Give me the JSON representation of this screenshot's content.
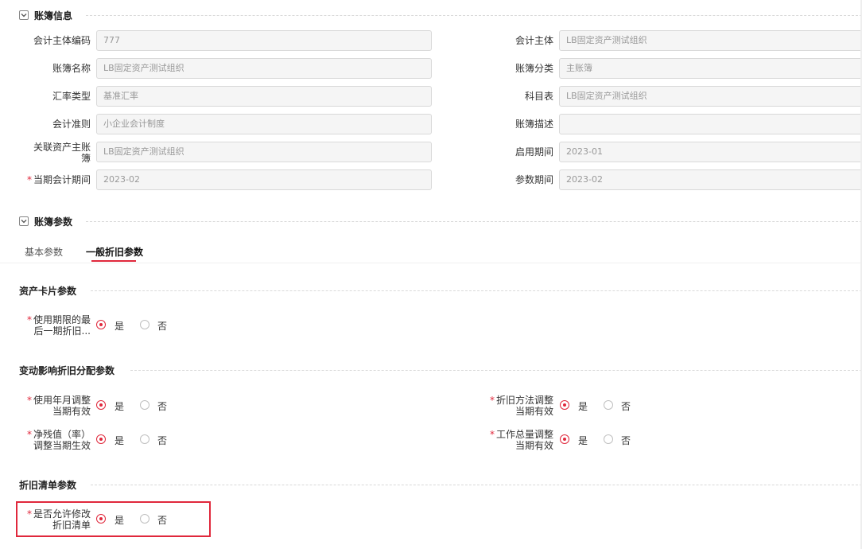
{
  "ledger_info": {
    "title": "账簿信息",
    "fields": [
      {
        "label": "会计主体编码",
        "value": "777"
      },
      {
        "label": "账簿名称",
        "value": "LB固定资产测试组织"
      },
      {
        "label": "汇率类型",
        "value": "基准汇率"
      },
      {
        "label": "会计准则",
        "value": "小企业会计制度"
      },
      {
        "label_line1": "关联资产主账",
        "label_line2": "簿",
        "value": "LB固定资产测试组织"
      },
      {
        "label": "当期会计期间",
        "required": "*",
        "value": "2023-02"
      }
    ],
    "fields_right": [
      {
        "label": "会计主体",
        "value": "LB固定资产测试组织"
      },
      {
        "label": "账簿分类",
        "value": "主账簿"
      },
      {
        "label": "科目表",
        "value": "LB固定资产测试组织"
      },
      {
        "label": "账簿描述",
        "value": ""
      },
      {
        "label": "启用期间",
        "value": "2023-01"
      },
      {
        "label": "参数期间",
        "value": "2023-02"
      }
    ]
  },
  "ledger_params": {
    "title": "账簿参数",
    "tabs": [
      {
        "label": "基本参数"
      },
      {
        "label": "一般折旧参数"
      }
    ]
  },
  "asset_card": {
    "title": "资产卡片参数",
    "items": [
      {
        "required": "*",
        "label_line1": "使用期限的最",
        "label_line2": "后一期折旧...",
        "yes": "是",
        "no": "否",
        "selected": "是"
      }
    ]
  },
  "change_alloc": {
    "title": "变动影响折旧分配参数",
    "items": [
      {
        "required": "*",
        "label_line1": "使用年月调整",
        "label_line2": "当期有效",
        "yes": "是",
        "no": "否",
        "selected": "是"
      },
      {
        "required": "*",
        "label_line1": "折旧方法调整",
        "label_line2": "当期有效",
        "yes": "是",
        "no": "否",
        "selected": "是"
      },
      {
        "required": "*",
        "label_line1": "净残值（率）",
        "label_line2": "调整当期生效",
        "yes": "是",
        "no": "否",
        "selected": "是"
      },
      {
        "required": "*",
        "label_line1": "工作总量调整",
        "label_line2": "当期有效",
        "yes": "是",
        "no": "否",
        "selected": "是"
      }
    ]
  },
  "dep_list": {
    "title": "折旧清单参数",
    "items": [
      {
        "required": "*",
        "label_line1": "是否允许修改",
        "label_line2": "折旧清单",
        "yes": "是",
        "no": "否",
        "selected": "是"
      }
    ]
  },
  "colors": {
    "accent": "#e0283c",
    "border": "#d9d9d9",
    "field_bg": "#f5f5f5"
  },
  "icons": [
    "chevron-down-icon"
  ]
}
